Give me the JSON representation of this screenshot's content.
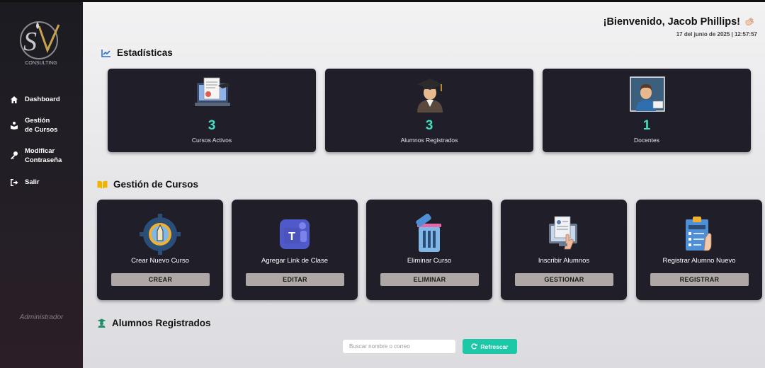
{
  "sidebar": {
    "logo": {
      "company": "CONSULTING"
    },
    "items": [
      {
        "label": "Dashboard",
        "icon": "home-icon"
      },
      {
        "label": "Gestión de Cursos",
        "icon": "book-reader-icon"
      },
      {
        "label": "Modificar Contraseña",
        "icon": "key-icon"
      },
      {
        "label": "Salir",
        "icon": "sign-out-icon"
      }
    ],
    "role": "Administrador"
  },
  "header": {
    "welcome": "¡Bienvenido, Jacob Phillips!",
    "datetime": "17 del junio de 2025 | 12:57:57"
  },
  "stats": {
    "title": "Estadísticas",
    "cards": [
      {
        "value": "3",
        "label": "Cursos Activos",
        "icon": "online-course-icon"
      },
      {
        "value": "3",
        "label": "Alumnos Registrados",
        "icon": "graduate-student-icon"
      },
      {
        "value": "1",
        "label": "Docentes",
        "icon": "teacher-icon"
      }
    ]
  },
  "courses": {
    "title": "Gestión de Cursos",
    "cards": [
      {
        "label": "Crear Nuevo Curso",
        "button": "CREAR",
        "icon": "gear-pencil-icon"
      },
      {
        "label": "Agregar Link de Clase",
        "button": "EDITAR",
        "icon": "teams-icon"
      },
      {
        "label": "Eliminar Curso",
        "button": "ELIMINAR",
        "icon": "trash-icon"
      },
      {
        "label": "Inscribir Alumnos",
        "button": "GESTIONAR",
        "icon": "enroll-icon"
      },
      {
        "label": "Registrar Alumno Nuevo",
        "button": "REGISTRAR",
        "icon": "clipboard-register-icon"
      }
    ]
  },
  "students": {
    "title": "Alumnos Registrados",
    "search_placeholder": "Buscar nombre o correo",
    "refresh_label": "Refrescar"
  },
  "colors": {
    "accent": "#1cc8a8",
    "stat_value": "#3fe0c0",
    "card_bg": "#1f1e29",
    "button_bg": "#aea7a5"
  }
}
